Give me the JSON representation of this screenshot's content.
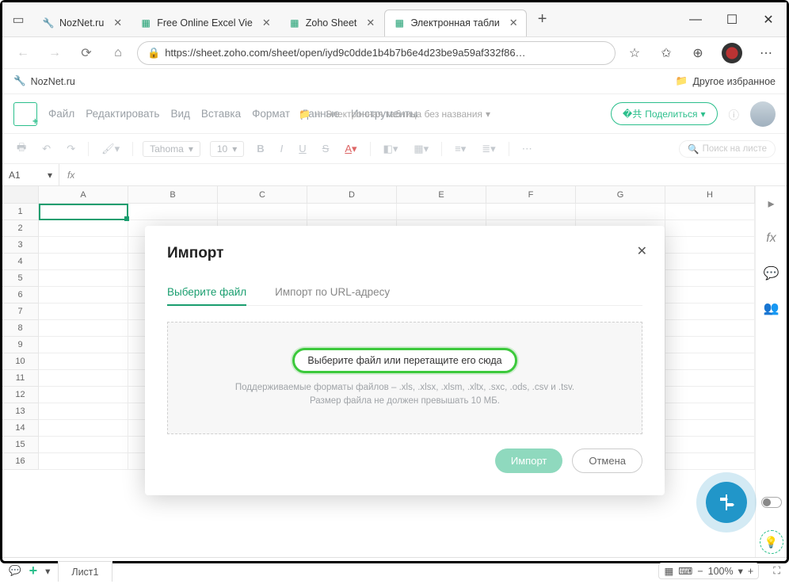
{
  "window": {
    "tabs": [
      {
        "title": "NozNet.ru",
        "icon": "wrench"
      },
      {
        "title": "Free Online Excel Vie",
        "icon": "zoho"
      },
      {
        "title": "Zoho Sheet",
        "icon": "zoho"
      },
      {
        "title": "Электронная табли",
        "icon": "zoho",
        "active": true
      }
    ],
    "controls": {
      "min": "—",
      "max": "☐",
      "close": "✕"
    }
  },
  "addressbar": {
    "url": "https://sheet.zoho.com/sheet/open/iyd9c0dde1b4b7b6e4d23be9a59af332f86…"
  },
  "bookmarks": {
    "left": "NozNet.ru",
    "right": "Другое избранное"
  },
  "zoho": {
    "menus": [
      "Файл",
      "Редактировать",
      "Вид",
      "Вставка",
      "Формат",
      "Данные",
      "Инструменты"
    ],
    "doc_title": "Электронная таблица без названия",
    "share": "Поделиться",
    "font": "Tahoma",
    "font_size": "10",
    "search_ph": "Поиск на листе",
    "cell_ref": "A1",
    "columns": [
      "A",
      "B",
      "C",
      "D",
      "E",
      "F",
      "G",
      "H"
    ],
    "rows": [
      "1",
      "2",
      "3",
      "4",
      "5",
      "6",
      "7",
      "8",
      "9",
      "10",
      "11",
      "12",
      "13",
      "14",
      "15",
      "16"
    ],
    "sheet": "Лист1",
    "zoom": "100%"
  },
  "modal": {
    "title": "Импорт",
    "tab1": "Выберите файл",
    "tab2": "Импорт по URL-адресу",
    "cta": "Выберите файл или перетащите его сюда",
    "hint1": "Поддерживаемые форматы файлов – .xls, .xlsx, .xlsm, .xltx, .sxc, .ods, .csv и .tsv.",
    "hint2": "Размер файла не должен превышать 10 МБ.",
    "import": "Импорт",
    "cancel": "Отмена"
  }
}
